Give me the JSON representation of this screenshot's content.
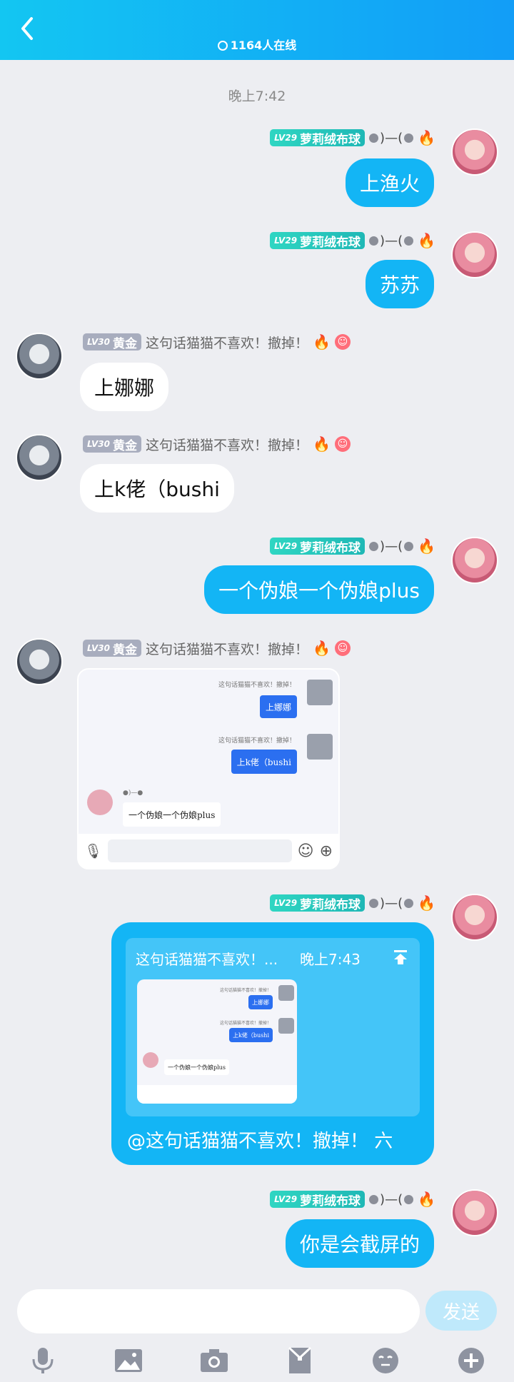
{
  "header": {
    "online": "1164人在线"
  },
  "timestamp": "晚上7:42",
  "users": {
    "me": {
      "level": "LV29",
      "name": "萝莉绒布球",
      "title": ")—("
    },
    "other": {
      "level": "LV30",
      "name": "黄金",
      "title": "这句话猫猫不喜欢！撤掉！"
    }
  },
  "messages": [
    {
      "text": "上渔火"
    },
    {
      "text": "苏苏"
    },
    {
      "text": "上娜娜"
    },
    {
      "text": "上k佬（bushi"
    },
    {
      "text": "一个伪娘一个伪娘plus"
    },
    {
      "screenshot": {
        "note1": "这句话猫猫不喜欢！撤掉！",
        "bubble1": "上娜娜",
        "note2": "这句话猫猫不喜欢！撤掉！",
        "bubble2": "上k佬（bushi",
        "name3": "●)—●",
        "bubble3": "一个伪娘一个伪娘plus"
      }
    },
    {
      "reply": {
        "quote_name": "这句话猫猫不喜欢！...",
        "quote_time": "晚上7:43",
        "mini_note1": "这句话猫猫不喜欢！撤掉！",
        "mini_bubble1": "上娜娜",
        "mini_note2": "这句话猫猫不喜欢！撤掉！",
        "mini_bubble2": "上k佬（bushi",
        "mini_bubble3": "一个伪娘一个伪娘plus",
        "text": "@这句话猫猫不喜欢！撤掉！ 六"
      }
    },
    {
      "text": "你是会截屏的"
    }
  ],
  "composer": {
    "send_label": "发送",
    "placeholder": ""
  },
  "toolbar": [
    "mic-icon",
    "image-icon",
    "camera-icon",
    "redpacket-icon",
    "emoji-icon",
    "plus-icon"
  ]
}
